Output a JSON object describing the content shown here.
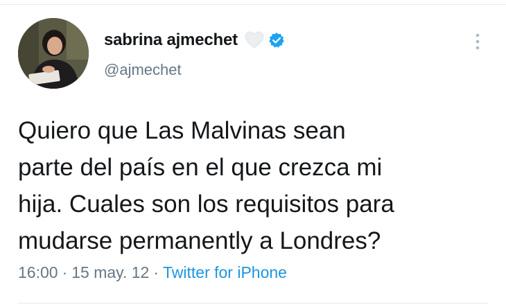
{
  "tweet": {
    "author": {
      "display_name": "sabrina ajmechet",
      "handle": "@ajmechet",
      "verified": true,
      "badge_icon": "heart-icon",
      "verified_icon": "verified-badge-icon",
      "verified_color": "#1da1f2"
    },
    "text": "Quiero que Las Malvinas sean\nparte del país en el que crezca mi\nhija. Cuales son los requisitos para\nmudarse permanently a Londres?",
    "time": "16:00",
    "date": "15 may. 12",
    "separator": "·",
    "source": "Twitter for iPhone",
    "source_color": "#1b95e0"
  },
  "menu": {
    "icon": "more-vertical-icon"
  }
}
